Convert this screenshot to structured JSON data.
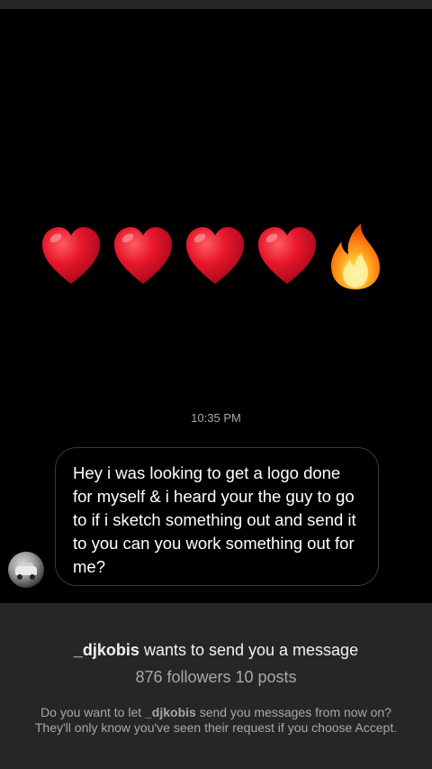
{
  "conversation": {
    "emoji_message": [
      "heart",
      "heart",
      "heart",
      "heart",
      "fire"
    ],
    "timestamp": "10:35 PM",
    "message_text": "Hey i was looking to get a logo done for myself & i heard your the guy to go to if i sketch something out and send it to you can you work something out for me?"
  },
  "request": {
    "username": "_djkobis",
    "title_suffix": " wants to send you a message",
    "stats": "876 followers 10 posts",
    "info_prefix": "Do you want to let ",
    "info_suffix": " send you messages from now on? They'll only know you've seen their request if you choose Accept."
  },
  "colors": {
    "background": "#000000",
    "panel": "#262626",
    "secondary_text": "#a8a8a8",
    "heart": "#e0142a"
  }
}
